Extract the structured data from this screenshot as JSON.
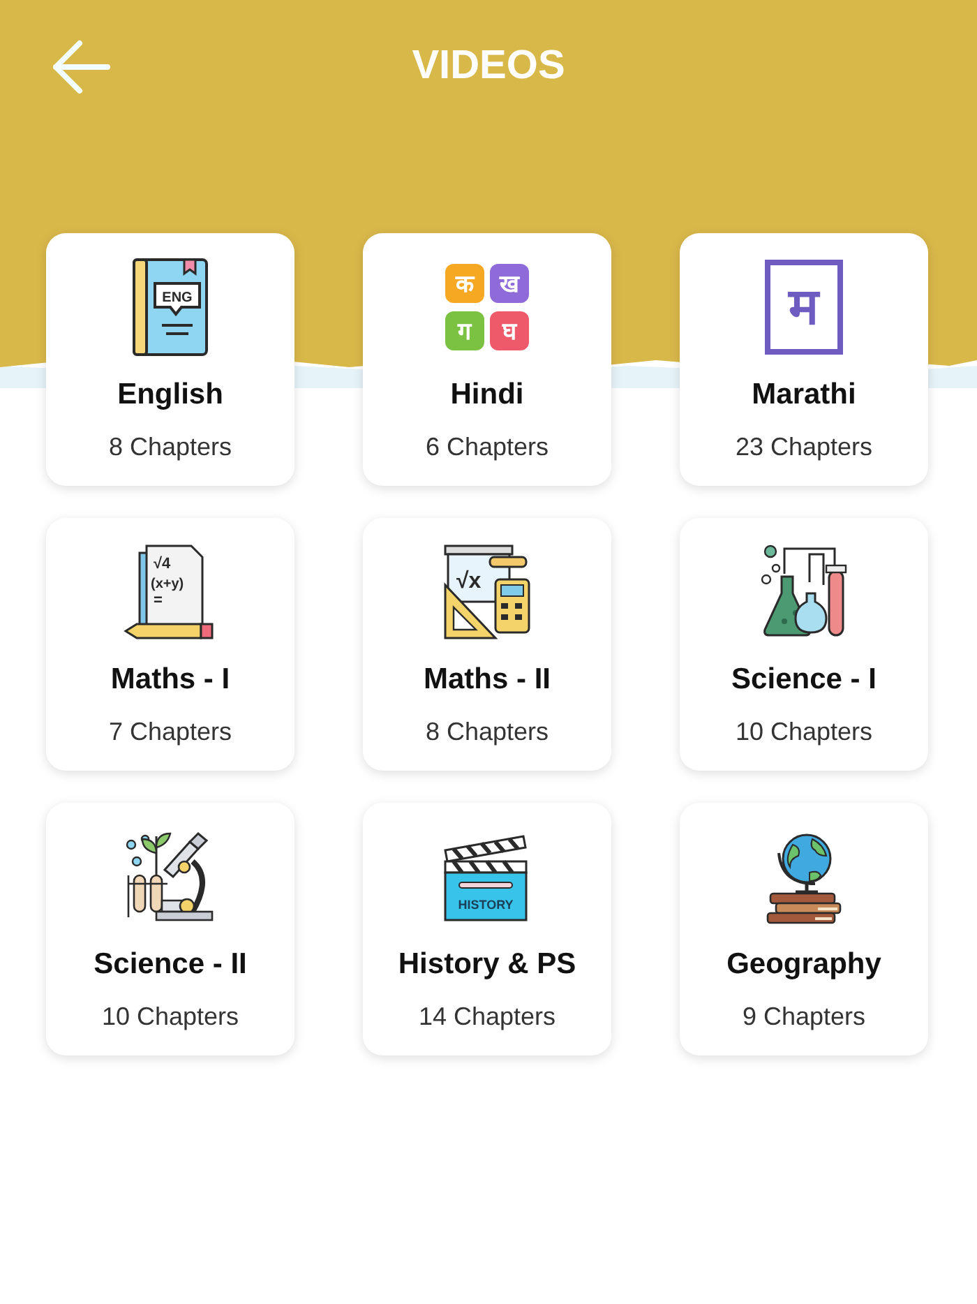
{
  "header": {
    "title": "VIDEOS"
  },
  "subjects": [
    {
      "title": "English",
      "chapters": "8 Chapters",
      "icon": {
        "kind": "book",
        "labels": [
          "ENG"
        ]
      }
    },
    {
      "title": "Hindi",
      "chapters": "6 Chapters",
      "icon": {
        "kind": "letter-tiles",
        "labels": [
          "क",
          "ख",
          "ग",
          "घ"
        ]
      }
    },
    {
      "title": "Marathi",
      "chapters": "23 Chapters",
      "icon": {
        "kind": "letter-frame",
        "labels": [
          "म"
        ]
      }
    },
    {
      "title": "Maths - I",
      "chapters": "7 Chapters",
      "icon": {
        "kind": "worksheet",
        "labels": [
          "√4",
          "(x+y)",
          "="
        ]
      }
    },
    {
      "title": "Maths - II",
      "chapters": "8 Chapters",
      "icon": {
        "kind": "board",
        "labels": [
          "√x"
        ]
      }
    },
    {
      "title": "Science - I",
      "chapters": "10 Chapters",
      "icon": {
        "kind": "flasks"
      }
    },
    {
      "title": "Science - II",
      "chapters": "10 Chapters",
      "icon": {
        "kind": "microscope"
      }
    },
    {
      "title": "History & PS",
      "chapters": "14 Chapters",
      "icon": {
        "kind": "clapperboard",
        "labels": [
          "HISTORY"
        ]
      }
    },
    {
      "title": "Geography",
      "chapters": "9 Chapters",
      "icon": {
        "kind": "globe"
      }
    }
  ]
}
